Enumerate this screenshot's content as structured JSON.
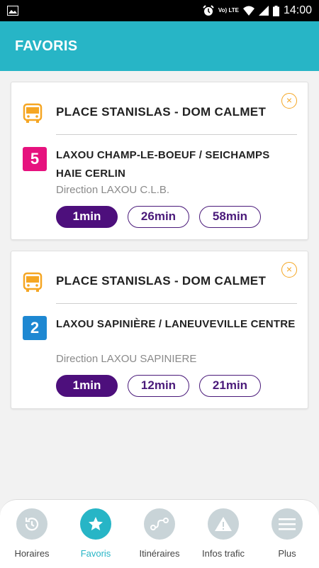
{
  "status_bar": {
    "time": "14:00",
    "network_label": "Vo) LTE",
    "icons": [
      "gallery-icon",
      "alarm-icon",
      "volte-icon",
      "wifi-icon",
      "signal-icon",
      "battery-icon"
    ]
  },
  "header": {
    "title": "FAVORIS",
    "background": "#27b5c6"
  },
  "favorites": [
    {
      "stop": "PLACE STANISLAS - DOM CALMET",
      "line_number": "5",
      "line_color": "#e6127e",
      "line_name": "LAXOU CHAMP-LE-BOEUF / SEICHAMPS HAIE CERLIN",
      "direction": "Direction LAXOU C.L.B.",
      "times": [
        "1min",
        "26min",
        "58min"
      ],
      "close_symbol": "×"
    },
    {
      "stop": "PLACE STANISLAS - DOM CALMET",
      "line_number": "2",
      "line_color": "#1e88d2",
      "line_name": "LAXOU SAPINIÈRE / LANEUVEVILLE CENTRE",
      "direction": "Direction LAXOU SAPINIERE",
      "times": [
        "1min",
        "12min",
        "21min"
      ],
      "close_symbol": "×"
    }
  ],
  "bottom_nav": {
    "items": [
      {
        "label": "Horaires",
        "icon": "clock-history-icon",
        "active": false
      },
      {
        "label": "Favoris",
        "icon": "star-icon",
        "active": true
      },
      {
        "label": "Itinéraires",
        "icon": "route-icon",
        "active": false
      },
      {
        "label": "Infos trafic",
        "icon": "warning-icon",
        "active": false
      },
      {
        "label": "Plus",
        "icon": "menu-icon",
        "active": false
      }
    ]
  },
  "colors": {
    "accent": "#27b5c6",
    "time_pill": "#4d0f7c",
    "bus_icon": "#f5a623"
  }
}
